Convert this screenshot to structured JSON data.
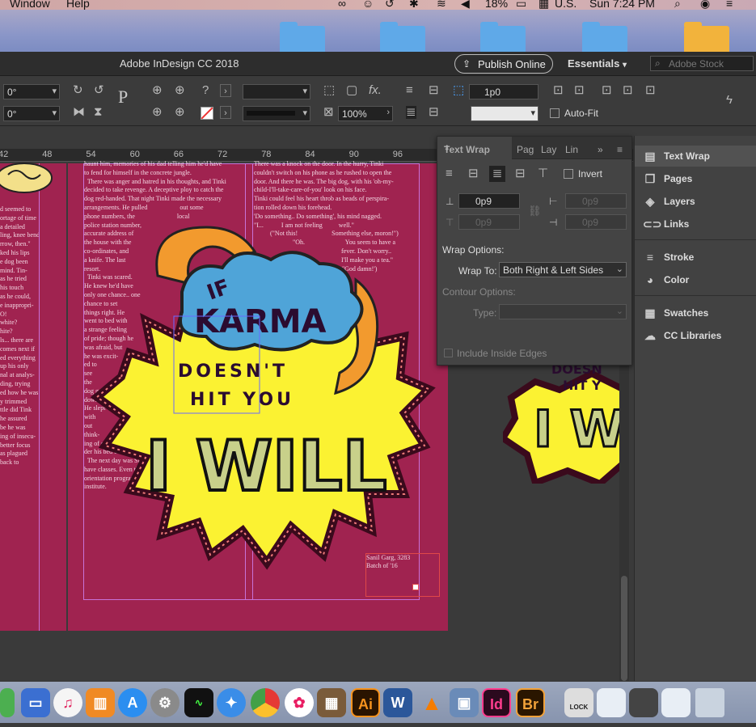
{
  "menubar": {
    "items": [
      "Window",
      "Help"
    ],
    "status": {
      "battery": "18%",
      "input_source": "U.S.",
      "clock": "Sun 7:24 PM"
    }
  },
  "titlebar": {
    "app_title": "Adobe InDesign CC 2018",
    "publish_label": "Publish Online",
    "workspace_label": "Essentials",
    "stock_placeholder": "Adobe Stock"
  },
  "control_panel": {
    "rotate_angle": "0°",
    "shear_angle": "0°",
    "stroke_weight": "1p0",
    "scale": "100%",
    "autofit_label": "Auto-Fit"
  },
  "ruler": {
    "ticks": [
      "42",
      "48",
      "54",
      "60",
      "66",
      "72",
      "78",
      "84",
      "90",
      "96"
    ]
  },
  "document": {
    "left_column": [
      "d seemed to",
      "ortage of time",
      "a detailed",
      "ling, knee bend-",
      "rrow, then.\"",
      "ked his lips",
      "",
      "",
      "e dog been",
      "mind. Tin-",
      "as he tried",
      "his touch",
      "as he could,",
      "e inappropri-",
      "",
      "O!",
      "",
      "white?",
      "hite?",
      "ls... there are",
      "",
      "",
      "comes next if",
      "",
      "",
      "",
      "ed everything",
      "up his only",
      "nal at analys-",
      "",
      "",
      "ding, trying",
      "ed how he was",
      "y trimmed",
      "ttle did Tink",
      "he assured",
      "be he was",
      "ing of insecu-",
      "better focus",
      "",
      "",
      "as plagued",
      "back to"
    ],
    "middle_column": [
      "haunt him, memories of his dad telling him he'd have",
      "to fend for himself in the concrete jungle.",
      "",
      "  There was anger and hatred in his thoughts, and Tinki",
      "decided to take revenge. A deceptive ploy to catch the",
      "dog red-handed. That night Tinki made the necessary",
      "arrangements. He pulled                    out some",
      "phone numbers, the                          local",
      "police station number,",
      "accurate address of",
      "the house with the",
      "co-ordinates, and",
      "a knife. The last",
      "resort.",
      "  Tinki was scared.",
      "He knew he'd have",
      "only one chance.. one",
      "chance to set",
      "things right. He",
      "went to bed with",
      "a strange feeling",
      "of pride; though he",
      "was afraid, but",
      "he was excit-",
      "ed to",
      "see",
      "the",
      "dog go",
      "down.",
      "He slept",
      "with",
      "",
      "",
      "",
      "",
      "",
      "",
      "",
      "",
      "out",
      "think-",
      "ing of ghosts                    un-",
      "der his bed or in                   the closet.",
      "",
      "  The next day was Sunday. From Monday, he'd",
      "have classes. Even that evening, he had to go to the",
      "orientation programme of the big coaching",
      "institute."
    ],
    "right_column": [
      "There was a knock on the door. In the hurry, Tinki",
      "couldn't switch on his phone as he rushed to open the",
      "door. And there he was. The big dog, with his 'oh-my-",
      "child-I'll-take-care-of-you' look on his face.",
      "Tinki could feel his heart throb as beads of perspira-",
      "tion rolled down his forehead.",
      "",
      "",
      "'Do something.. Do something', his mind nagged.",
      "\"I...           I am not feeling          well.\"",
      "          (\"Not this!                     Something else, moron!\")",
      "                        \"Oh.                         You seem to have a",
      "                                                      fever. Don't worry..",
      "                                                      I'll make you a tea.\"",
      "                                                      ('God damn!')"
    ],
    "credit": [
      "Sanil Garg, 3283",
      "Batch of '16"
    ],
    "art_text": {
      "top": "IF",
      "cloud": "KARMA",
      "middle1": "DOESN'T",
      "middle2": "HIT YOU",
      "big": "I WILL"
    },
    "art_dup_text": {
      "line1": "DOESN",
      "line2": "HIT Y",
      "big": "I W"
    }
  },
  "text_wrap_panel": {
    "tabs": [
      "Text Wrap",
      "Pag",
      "Lay",
      "Lin"
    ],
    "invert_label": "Invert",
    "offsets": [
      "0p9",
      "0p9",
      "0p9",
      "0p9"
    ],
    "wrap_options_label": "Wrap Options:",
    "wrap_to_label": "Wrap To:",
    "wrap_to_value": "Both Right & Left Sides",
    "contour_options_label": "Contour Options:",
    "type_label": "Type:",
    "type_value": "",
    "include_inside_edges_label": "Include Inside Edges"
  },
  "dock_panels": [
    {
      "label": "Text Wrap",
      "icon": "text-wrap-icon"
    },
    {
      "label": "Pages",
      "icon": "pages-icon"
    },
    {
      "label": "Layers",
      "icon": "layers-icon"
    },
    {
      "label": "Links",
      "icon": "links-icon"
    },
    {
      "label": "Stroke",
      "icon": "stroke-icon"
    },
    {
      "label": "Color",
      "icon": "color-icon"
    },
    {
      "label": "Swatches",
      "icon": "swatches-icon"
    },
    {
      "label": "CC Libraries",
      "icon": "cc-libraries-icon"
    }
  ],
  "dock_apps": {
    "illustrator": "Ai",
    "word": "W",
    "indesign": "Id",
    "bridge": "Br",
    "lock": "LOCK"
  },
  "colors": {
    "page": "#a02350",
    "art_yellow": "#fbf232",
    "cloud": "#4fa4d8",
    "arrow_orange": "#f29a2e"
  }
}
